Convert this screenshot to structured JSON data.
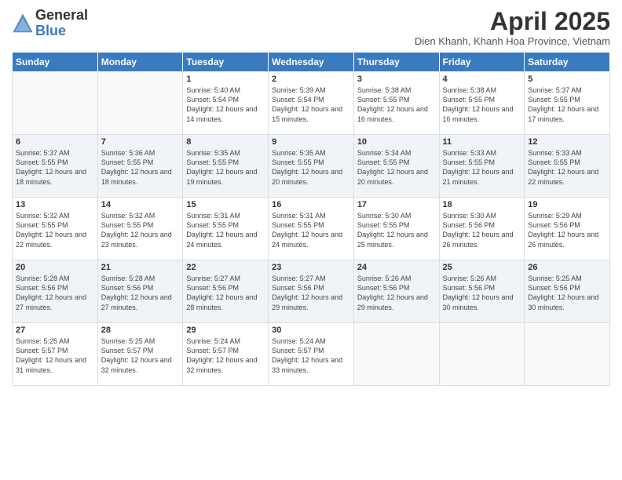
{
  "header": {
    "logo_general": "General",
    "logo_blue": "Blue",
    "month_title": "April 2025",
    "subtitle": "Dien Khanh, Khanh Hoa Province, Vietnam"
  },
  "days_of_week": [
    "Sunday",
    "Monday",
    "Tuesday",
    "Wednesday",
    "Thursday",
    "Friday",
    "Saturday"
  ],
  "weeks": [
    [
      {
        "day": "",
        "sunrise": "",
        "sunset": "",
        "daylight": "",
        "empty": true
      },
      {
        "day": "",
        "sunrise": "",
        "sunset": "",
        "daylight": "",
        "empty": true
      },
      {
        "day": "1",
        "sunrise": "Sunrise: 5:40 AM",
        "sunset": "Sunset: 5:54 PM",
        "daylight": "Daylight: 12 hours and 14 minutes."
      },
      {
        "day": "2",
        "sunrise": "Sunrise: 5:39 AM",
        "sunset": "Sunset: 5:54 PM",
        "daylight": "Daylight: 12 hours and 15 minutes."
      },
      {
        "day": "3",
        "sunrise": "Sunrise: 5:38 AM",
        "sunset": "Sunset: 5:55 PM",
        "daylight": "Daylight: 12 hours and 16 minutes."
      },
      {
        "day": "4",
        "sunrise": "Sunrise: 5:38 AM",
        "sunset": "Sunset: 5:55 PM",
        "daylight": "Daylight: 12 hours and 16 minutes."
      },
      {
        "day": "5",
        "sunrise": "Sunrise: 5:37 AM",
        "sunset": "Sunset: 5:55 PM",
        "daylight": "Daylight: 12 hours and 17 minutes."
      }
    ],
    [
      {
        "day": "6",
        "sunrise": "Sunrise: 5:37 AM",
        "sunset": "Sunset: 5:55 PM",
        "daylight": "Daylight: 12 hours and 18 minutes."
      },
      {
        "day": "7",
        "sunrise": "Sunrise: 5:36 AM",
        "sunset": "Sunset: 5:55 PM",
        "daylight": "Daylight: 12 hours and 18 minutes."
      },
      {
        "day": "8",
        "sunrise": "Sunrise: 5:35 AM",
        "sunset": "Sunset: 5:55 PM",
        "daylight": "Daylight: 12 hours and 19 minutes."
      },
      {
        "day": "9",
        "sunrise": "Sunrise: 5:35 AM",
        "sunset": "Sunset: 5:55 PM",
        "daylight": "Daylight: 12 hours and 20 minutes."
      },
      {
        "day": "10",
        "sunrise": "Sunrise: 5:34 AM",
        "sunset": "Sunset: 5:55 PM",
        "daylight": "Daylight: 12 hours and 20 minutes."
      },
      {
        "day": "11",
        "sunrise": "Sunrise: 5:33 AM",
        "sunset": "Sunset: 5:55 PM",
        "daylight": "Daylight: 12 hours and 21 minutes."
      },
      {
        "day": "12",
        "sunrise": "Sunrise: 5:33 AM",
        "sunset": "Sunset: 5:55 PM",
        "daylight": "Daylight: 12 hours and 22 minutes."
      }
    ],
    [
      {
        "day": "13",
        "sunrise": "Sunrise: 5:32 AM",
        "sunset": "Sunset: 5:55 PM",
        "daylight": "Daylight: 12 hours and 22 minutes."
      },
      {
        "day": "14",
        "sunrise": "Sunrise: 5:32 AM",
        "sunset": "Sunset: 5:55 PM",
        "daylight": "Daylight: 12 hours and 23 minutes."
      },
      {
        "day": "15",
        "sunrise": "Sunrise: 5:31 AM",
        "sunset": "Sunset: 5:55 PM",
        "daylight": "Daylight: 12 hours and 24 minutes."
      },
      {
        "day": "16",
        "sunrise": "Sunrise: 5:31 AM",
        "sunset": "Sunset: 5:55 PM",
        "daylight": "Daylight: 12 hours and 24 minutes."
      },
      {
        "day": "17",
        "sunrise": "Sunrise: 5:30 AM",
        "sunset": "Sunset: 5:55 PM",
        "daylight": "Daylight: 12 hours and 25 minutes."
      },
      {
        "day": "18",
        "sunrise": "Sunrise: 5:30 AM",
        "sunset": "Sunset: 5:56 PM",
        "daylight": "Daylight: 12 hours and 26 minutes."
      },
      {
        "day": "19",
        "sunrise": "Sunrise: 5:29 AM",
        "sunset": "Sunset: 5:56 PM",
        "daylight": "Daylight: 12 hours and 26 minutes."
      }
    ],
    [
      {
        "day": "20",
        "sunrise": "Sunrise: 5:28 AM",
        "sunset": "Sunset: 5:56 PM",
        "daylight": "Daylight: 12 hours and 27 minutes."
      },
      {
        "day": "21",
        "sunrise": "Sunrise: 5:28 AM",
        "sunset": "Sunset: 5:56 PM",
        "daylight": "Daylight: 12 hours and 27 minutes."
      },
      {
        "day": "22",
        "sunrise": "Sunrise: 5:27 AM",
        "sunset": "Sunset: 5:56 PM",
        "daylight": "Daylight: 12 hours and 28 minutes."
      },
      {
        "day": "23",
        "sunrise": "Sunrise: 5:27 AM",
        "sunset": "Sunset: 5:56 PM",
        "daylight": "Daylight: 12 hours and 29 minutes."
      },
      {
        "day": "24",
        "sunrise": "Sunrise: 5:26 AM",
        "sunset": "Sunset: 5:56 PM",
        "daylight": "Daylight: 12 hours and 29 minutes."
      },
      {
        "day": "25",
        "sunrise": "Sunrise: 5:26 AM",
        "sunset": "Sunset: 5:56 PM",
        "daylight": "Daylight: 12 hours and 30 minutes."
      },
      {
        "day": "26",
        "sunrise": "Sunrise: 5:25 AM",
        "sunset": "Sunset: 5:56 PM",
        "daylight": "Daylight: 12 hours and 30 minutes."
      }
    ],
    [
      {
        "day": "27",
        "sunrise": "Sunrise: 5:25 AM",
        "sunset": "Sunset: 5:57 PM",
        "daylight": "Daylight: 12 hours and 31 minutes."
      },
      {
        "day": "28",
        "sunrise": "Sunrise: 5:25 AM",
        "sunset": "Sunset: 5:57 PM",
        "daylight": "Daylight: 12 hours and 32 minutes."
      },
      {
        "day": "29",
        "sunrise": "Sunrise: 5:24 AM",
        "sunset": "Sunset: 5:57 PM",
        "daylight": "Daylight: 12 hours and 32 minutes."
      },
      {
        "day": "30",
        "sunrise": "Sunrise: 5:24 AM",
        "sunset": "Sunset: 5:57 PM",
        "daylight": "Daylight: 12 hours and 33 minutes."
      },
      {
        "day": "",
        "sunrise": "",
        "sunset": "",
        "daylight": "",
        "empty": true
      },
      {
        "day": "",
        "sunrise": "",
        "sunset": "",
        "daylight": "",
        "empty": true
      },
      {
        "day": "",
        "sunrise": "",
        "sunset": "",
        "daylight": "",
        "empty": true
      }
    ]
  ]
}
